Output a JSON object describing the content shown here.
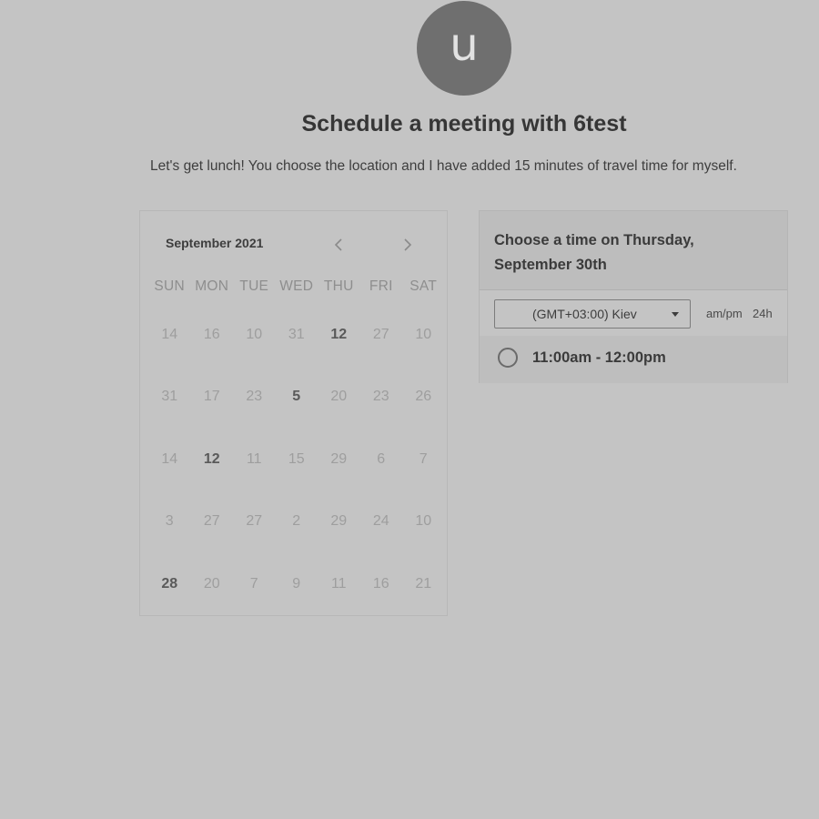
{
  "host": {
    "avatar_letter": "u"
  },
  "header": {
    "title": "Schedule a meeting with 6test",
    "description": "Let's get lunch! You choose the location and I have added 15 minutes of travel time for myself."
  },
  "calendar": {
    "month_label": "September 2021",
    "prev_icon": "chevron-left-icon",
    "next_icon": "chevron-right-icon",
    "weekdays": [
      "SUN",
      "MON",
      "TUE",
      "WED",
      "THU",
      "FRI",
      "SAT"
    ],
    "weeks": [
      [
        "14",
        "16",
        "10",
        "31",
        "12",
        "27",
        "10"
      ],
      [
        "31",
        "17",
        "23",
        "5",
        "20",
        "23",
        "26"
      ],
      [
        "14",
        "12",
        "11",
        "15",
        "29",
        "6",
        "7"
      ],
      [
        "3",
        "27",
        "27",
        "2",
        "29",
        "24",
        "10"
      ],
      [
        "28",
        "20",
        "7",
        "9",
        "11",
        "16",
        "21"
      ]
    ],
    "bold_days": [
      [
        0,
        4
      ],
      [
        1,
        3
      ],
      [
        2,
        1
      ],
      [
        4,
        0
      ]
    ]
  },
  "times": {
    "heading": "Choose a time on Thursday, September 30th",
    "timezone": "(GMT+03:00) Kiev",
    "format_ampm": "am/pm",
    "format_24h": "24h",
    "slots": [
      {
        "label": "11:00am - 12:00pm"
      }
    ]
  }
}
